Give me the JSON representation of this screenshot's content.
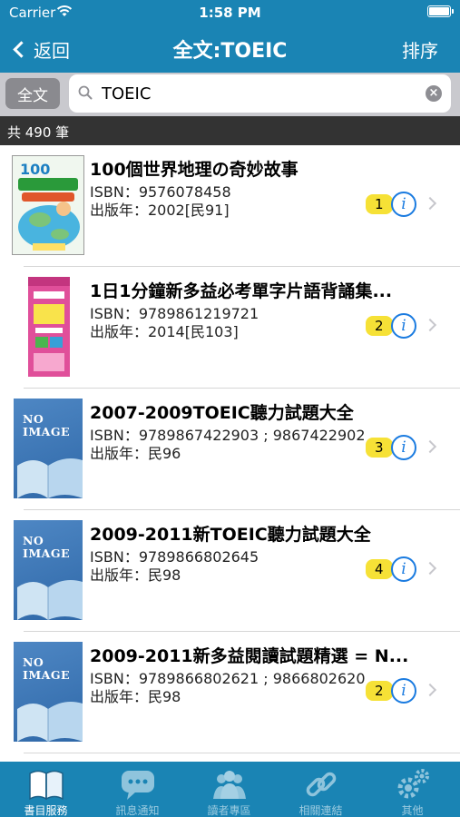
{
  "status": {
    "carrier": "Carrier",
    "time": "1:58 PM"
  },
  "nav": {
    "back_label": "返回",
    "title": "全文:TOEIC",
    "sort_label": "排序"
  },
  "search": {
    "scope": "全文",
    "query": "TOEIC"
  },
  "count_label": "共 490 筆",
  "results": [
    {
      "title": "100個世界地理の奇妙故事",
      "isbn": "ISBN：9576078458",
      "year": "出版年：2002[民91]",
      "badge": "1",
      "cover": "cover-100-geography"
    },
    {
      "title": "1日1分鐘新多益必考單字片語背誦集...",
      "isbn": "ISBN：9789861219721",
      "year": "出版年：2014[民103]",
      "badge": "2",
      "cover": "cover-toeic-vocab"
    },
    {
      "title": "2007-2009TOEIC聽力試題大全",
      "isbn": "ISBN：9789867422903 ; 9867422902",
      "year": "出版年：民96",
      "badge": "3",
      "cover": "no-image",
      "noimage_label": "NO\nIMAGE"
    },
    {
      "title": "2009-2011新TOEIC聽力試題大全",
      "isbn": "ISBN：9789866802645",
      "year": "出版年：民98",
      "badge": "4",
      "cover": "no-image",
      "noimage_label": "NO\nIMAGE"
    },
    {
      "title": "2009-2011新多益閱讀試題精選 = N...",
      "isbn": "ISBN：9789866802621 ; 9866802620",
      "year": "出版年：民98",
      "badge": "2",
      "cover": "no-image",
      "noimage_label": "NO\nIMAGE"
    }
  ],
  "tabs": [
    {
      "label": "書目服務",
      "icon": "book-icon",
      "active": true
    },
    {
      "label": "訊息通知",
      "icon": "chat-bubble-icon",
      "active": false
    },
    {
      "label": "讀者專區",
      "icon": "users-icon",
      "active": false
    },
    {
      "label": "相關連結",
      "icon": "link-icon",
      "active": false
    },
    {
      "label": "其他",
      "icon": "gears-icon",
      "active": false
    }
  ],
  "colors": {
    "bar": "#1a84b4",
    "badge": "#f6e136",
    "info": "#1a7be0"
  }
}
